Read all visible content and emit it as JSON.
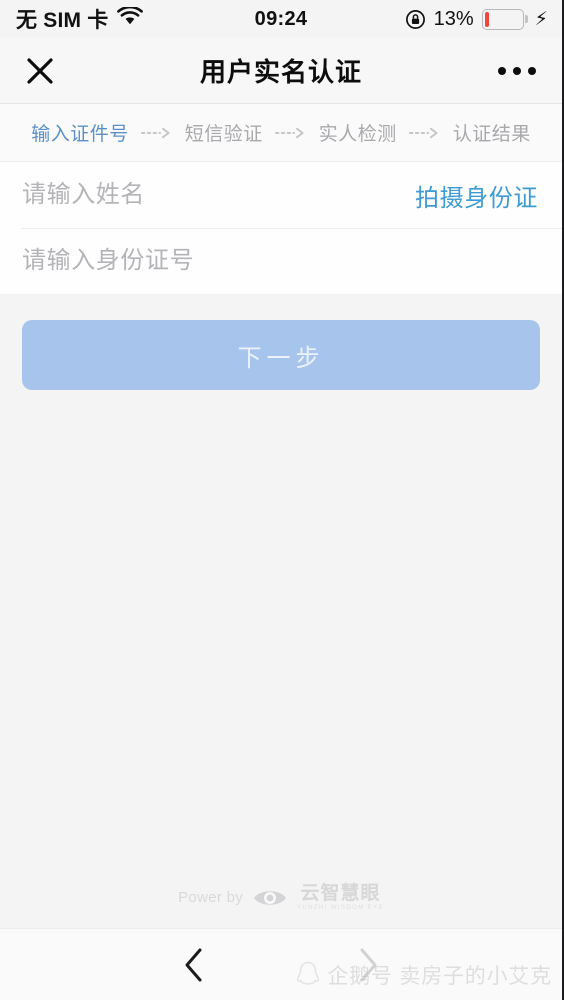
{
  "status_bar": {
    "carrier": "无 SIM 卡",
    "wifi_icon": "wifi-icon",
    "time": "09:24",
    "rotation_lock_icon": "rotation-lock-icon",
    "battery_percent": "13%",
    "battery_level": 13,
    "charging_icon": "lightning-bolt-icon",
    "battery_color": "#f1443a"
  },
  "header": {
    "close_icon": "close-icon",
    "title": "用户实名认证",
    "more_icon": "more-options-icon"
  },
  "steps": {
    "separator_icon": "dotted-arrow-icon",
    "active_color": "#5d90c6",
    "inactive_color": "#a9a9ad",
    "items": [
      {
        "label": "输入证件号",
        "active": true
      },
      {
        "label": "短信验证",
        "active": false
      },
      {
        "label": "实人检测",
        "active": false
      },
      {
        "label": "认证结果",
        "active": false
      }
    ]
  },
  "form": {
    "name_field": {
      "value": "",
      "placeholder": "请输入姓名"
    },
    "id_field": {
      "value": "",
      "placeholder": "请输入身份证号"
    },
    "shoot_id_link": "拍摄身份证",
    "link_color": "#3f9bd4"
  },
  "action": {
    "next_label": "下一步",
    "button_color": "#a7c5ec",
    "disabled": true
  },
  "footer": {
    "power_by": "Power by",
    "logo_icon": "eye-logo-icon",
    "brand_cn": "云智慧眼",
    "brand_en": "YUNZHI WISDOM EYE"
  },
  "bottom_nav": {
    "back_icon": "chevron-left-icon",
    "forward_icon": "chevron-right-icon"
  },
  "watermark": {
    "penguin_icon": "qq-penguin-icon",
    "text": "企鹅号 卖房子的小艾克"
  }
}
